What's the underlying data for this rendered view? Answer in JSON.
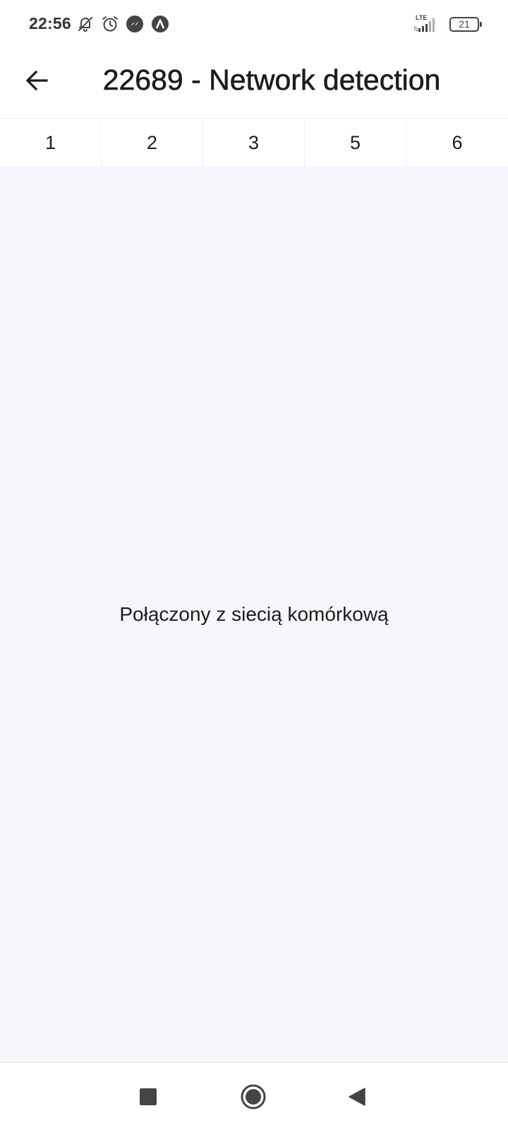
{
  "status_bar": {
    "time": "22:56",
    "network": "LTE",
    "battery": "21",
    "icons": [
      "bell-off-icon",
      "alarm-icon",
      "messenger-icon",
      "app-notification-icon",
      "signal-icon",
      "battery-icon"
    ]
  },
  "header": {
    "title": "22689 - Network detection",
    "back_icon": "arrow-left-icon"
  },
  "tabs": [
    {
      "label": "1"
    },
    {
      "label": "2"
    },
    {
      "label": "3"
    },
    {
      "label": "5"
    },
    {
      "label": "6"
    }
  ],
  "main": {
    "message": "Połączony z siecią komórkową"
  },
  "nav": {
    "icons": [
      "recent-apps-icon",
      "home-icon",
      "back-triangle-icon"
    ]
  },
  "colors": {
    "background": "#f5f7fc",
    "surface": "#ffffff",
    "text": "#1c1c1c"
  }
}
